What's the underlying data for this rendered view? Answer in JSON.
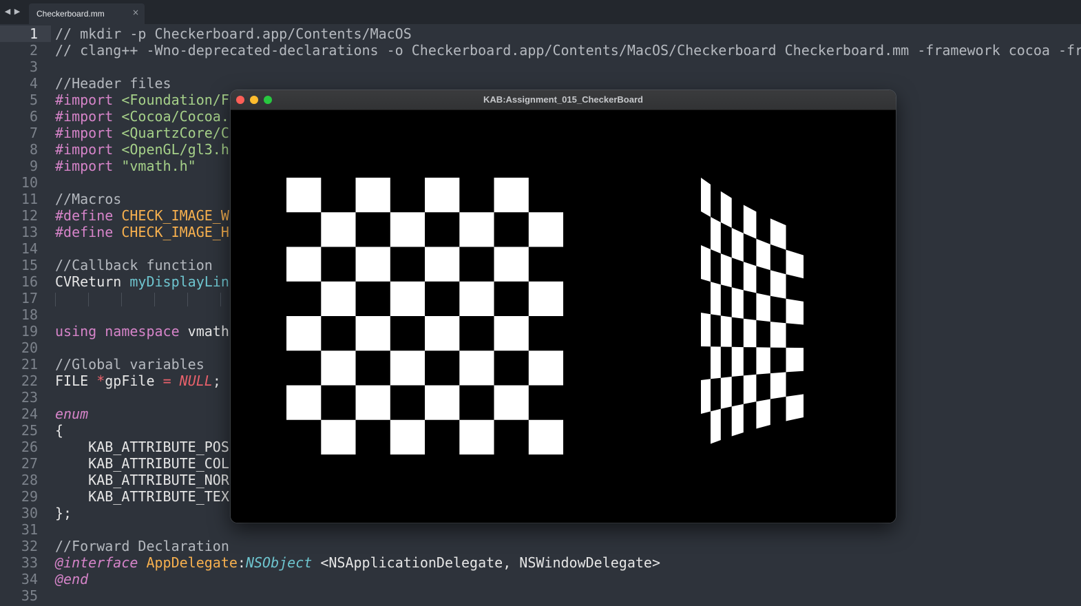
{
  "editor": {
    "nav_back": "◀",
    "nav_forward": "▶",
    "tab": {
      "label": "Checkerboard.mm",
      "close": "×"
    },
    "active_line": 1
  },
  "code_lines": [
    {
      "n": "1",
      "segs": [
        [
          "c-comment",
          "// mkdir -p Checkerboard.app/Contents/MacOS"
        ]
      ]
    },
    {
      "n": "2",
      "segs": [
        [
          "c-comment",
          "// clang++ -Wno-deprecated-declarations -o Checkerboard.app/Contents/MacOS/Checkerboard Checkerboard.mm -framework cocoa -fr"
        ]
      ]
    },
    {
      "n": "3",
      "segs": []
    },
    {
      "n": "4",
      "segs": [
        [
          "c-comment",
          "//Header files"
        ]
      ]
    },
    {
      "n": "5",
      "segs": [
        [
          "c-pre",
          "#import "
        ],
        [
          "c-str",
          "<Foundation/F"
        ]
      ]
    },
    {
      "n": "6",
      "segs": [
        [
          "c-pre",
          "#import "
        ],
        [
          "c-str",
          "<Cocoa/Cocoa."
        ]
      ]
    },
    {
      "n": "7",
      "segs": [
        [
          "c-pre",
          "#import "
        ],
        [
          "c-str",
          "<QuartzCore/C"
        ]
      ]
    },
    {
      "n": "8",
      "segs": [
        [
          "c-pre",
          "#import "
        ],
        [
          "c-str",
          "<OpenGL/gl3.h"
        ]
      ]
    },
    {
      "n": "9",
      "segs": [
        [
          "c-pre",
          "#import "
        ],
        [
          "c-str",
          "\"vmath.h\""
        ]
      ]
    },
    {
      "n": "10",
      "segs": []
    },
    {
      "n": "11",
      "segs": [
        [
          "c-comment",
          "//Macros"
        ]
      ]
    },
    {
      "n": "12",
      "segs": [
        [
          "c-pre",
          "#define "
        ],
        [
          "c-macro",
          "CHECK_IMAGE_W"
        ]
      ]
    },
    {
      "n": "13",
      "segs": [
        [
          "c-pre",
          "#define "
        ],
        [
          "c-macro",
          "CHECK_IMAGE_H"
        ]
      ]
    },
    {
      "n": "14",
      "segs": []
    },
    {
      "n": "15",
      "segs": [
        [
          "c-comment",
          "//Callback function"
        ]
      ]
    },
    {
      "n": "16",
      "segs": [
        [
          "c-type",
          "CVReturn "
        ],
        [
          "c-func",
          "myDisplayLin"
        ]
      ]
    },
    {
      "n": "17",
      "segs": []
    },
    {
      "n": "18",
      "segs": []
    },
    {
      "n": "19",
      "segs": [
        [
          "c-kw",
          "using namespace "
        ],
        [
          "c-type",
          "vmath"
        ]
      ]
    },
    {
      "n": "20",
      "segs": []
    },
    {
      "n": "21",
      "segs": [
        [
          "c-comment",
          "//Global variables"
        ]
      ]
    },
    {
      "n": "22",
      "segs": [
        [
          "c-type",
          "FILE "
        ],
        [
          "c-op",
          "*"
        ],
        [
          "c-type",
          "gpFile "
        ],
        [
          "c-op",
          "= "
        ],
        [
          "c-null",
          "NULL"
        ],
        [
          "c-type",
          ";"
        ]
      ]
    },
    {
      "n": "23",
      "segs": []
    },
    {
      "n": "24",
      "segs": [
        [
          "c-enum",
          "enum"
        ]
      ]
    },
    {
      "n": "25",
      "segs": [
        [
          "c-type",
          "{"
        ]
      ]
    },
    {
      "n": "26",
      "segs": [
        [
          "c-type",
          "    KAB_ATTRIBUTE_POS"
        ]
      ]
    },
    {
      "n": "27",
      "segs": [
        [
          "c-type",
          "    KAB_ATTRIBUTE_COL"
        ]
      ]
    },
    {
      "n": "28",
      "segs": [
        [
          "c-type",
          "    KAB_ATTRIBUTE_NOR"
        ]
      ]
    },
    {
      "n": "29",
      "segs": [
        [
          "c-type",
          "    KAB_ATTRIBUTE_TEX"
        ]
      ]
    },
    {
      "n": "30",
      "segs": [
        [
          "c-type",
          "};"
        ]
      ]
    },
    {
      "n": "31",
      "segs": []
    },
    {
      "n": "32",
      "segs": [
        [
          "c-comment",
          "//Forward Declaration"
        ]
      ]
    },
    {
      "n": "33",
      "segs": [
        [
          "c-enum",
          "@interface "
        ],
        [
          "c-class",
          "AppDelegate"
        ],
        [
          "c-type",
          ":"
        ],
        [
          "c-base",
          "NSObject"
        ],
        [
          "c-type",
          " <NSApplicationDelegate, NSWindowDelegate>"
        ]
      ]
    },
    {
      "n": "34",
      "segs": [
        [
          "c-enum",
          "@end"
        ]
      ]
    },
    {
      "n": "35",
      "segs": []
    }
  ],
  "window": {
    "title": "KAB:Assignment_015_CheckerBoard",
    "colors": {
      "close": "#fe5f57",
      "minimize": "#febc2e",
      "maximize": "#28c840"
    }
  },
  "scene": {
    "checker_cols": 8,
    "checker_rows": 8,
    "square_color": "#ffffff",
    "background_color": "#000000"
  }
}
